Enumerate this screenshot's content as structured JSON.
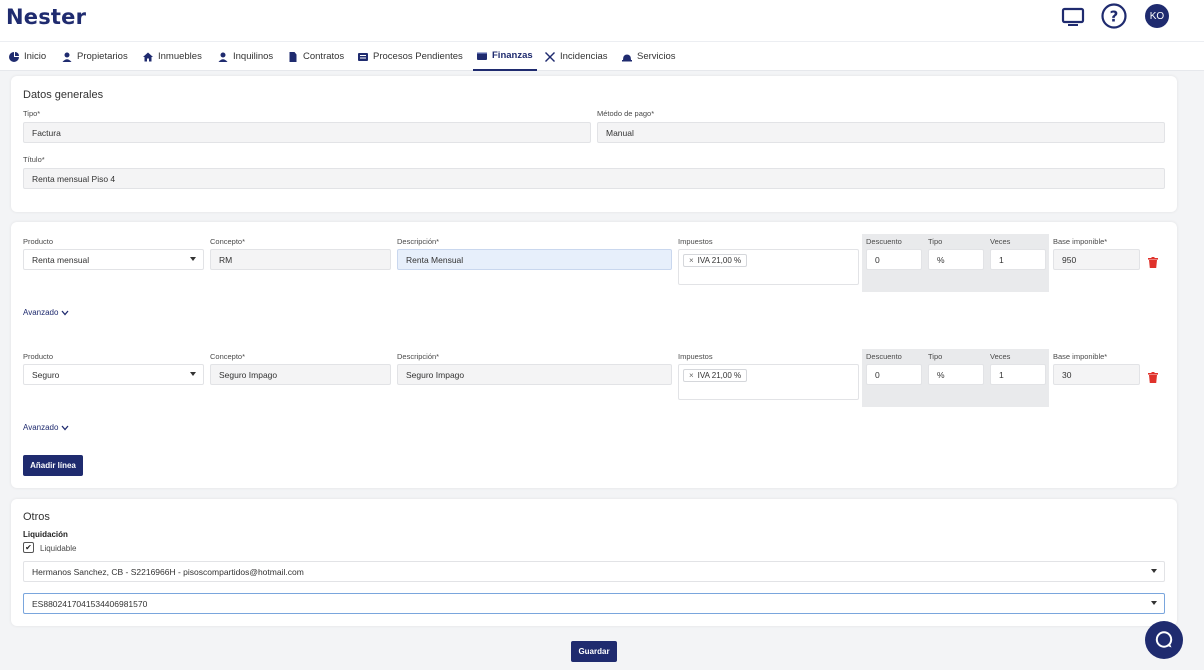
{
  "header": {
    "logo": "Nester",
    "avatar": "KO"
  },
  "nav": [
    {
      "label": "Inicio",
      "icon": "pie-chart-icon"
    },
    {
      "label": "Propietarios",
      "icon": "user-icon"
    },
    {
      "label": "Inmuebles",
      "icon": "home-icon"
    },
    {
      "label": "Inquilinos",
      "icon": "user-icon"
    },
    {
      "label": "Contratos",
      "icon": "file-icon"
    },
    {
      "label": "Procesos Pendientes",
      "icon": "list-icon"
    },
    {
      "label": "Finanzas",
      "icon": "wallet-icon",
      "active": true
    },
    {
      "label": "Incidencias",
      "icon": "tools-icon"
    },
    {
      "label": "Servicios",
      "icon": "service-bell-icon"
    }
  ],
  "general": {
    "title": "Datos generales",
    "tipo_label": "Tipo*",
    "tipo_value": "Factura",
    "metodo_label": "Método de pago*",
    "metodo_value": "Manual",
    "titulo_label": "Título*",
    "titulo_value": "Renta mensual Piso 4"
  },
  "columns": {
    "producto": "Producto",
    "concepto": "Concepto*",
    "descripcion": "Descripción*",
    "impuestos": "Impuestos",
    "descuento": "Descuento",
    "tipo": "Tipo",
    "veces": "Veces",
    "base": "Base imponible*"
  },
  "lines": [
    {
      "producto": "Renta mensual",
      "concepto": "RM",
      "descripcion": "Renta Mensual",
      "impuesto": "IVA 21,00 %",
      "descuento": "0",
      "tipo": "%",
      "veces": "1",
      "base": "950",
      "advanced": "Avanzado"
    },
    {
      "producto": "Seguro",
      "concepto": "Seguro Impago",
      "descripcion": "Seguro Impago",
      "impuesto": "IVA 21,00 %",
      "descuento": "0",
      "tipo": "%",
      "veces": "1",
      "base": "30",
      "advanced": "Avanzado"
    }
  ],
  "tag_remove": "×",
  "add_line_label": "Añadir línea",
  "otros": {
    "title": "Otros",
    "liquidacion_label": "Liquidación",
    "liquidable_label": "Liquidable",
    "liquidable_checked": true,
    "check_mark": "✔",
    "account_value": "Hermanos Sanchez, CB - S2216966H - pisoscompartidos@hotmail.com",
    "iban_value": "ES8802417041534406981570"
  },
  "save_label": "Guardar",
  "colors": {
    "primary": "#1f2b6f",
    "danger": "#e0322b",
    "focus_border": "#7aa6dd"
  }
}
